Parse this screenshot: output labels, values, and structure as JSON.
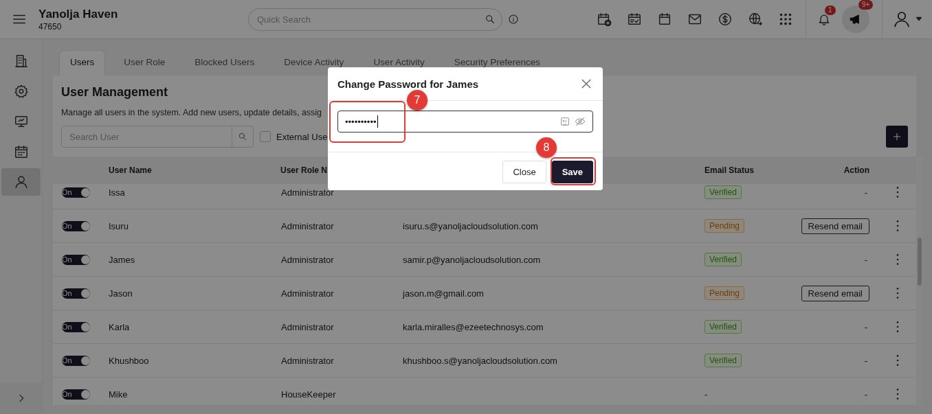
{
  "header": {
    "property_name": "Yanolja Haven",
    "property_code": "47650",
    "search": {
      "placeholder": "Quick Search"
    },
    "notification_badge": "1",
    "announcement_badge": "9+"
  },
  "sidebar": {
    "items": [
      {
        "kind": "building",
        "selected": false
      },
      {
        "kind": "gear",
        "selected": false
      },
      {
        "kind": "monitor",
        "selected": false
      },
      {
        "kind": "calendar",
        "selected": false
      },
      {
        "kind": "user",
        "selected": true
      }
    ]
  },
  "tabs": [
    {
      "label": "Users",
      "selected": true
    },
    {
      "label": "User Role",
      "selected": false
    },
    {
      "label": "Blocked Users",
      "selected": false
    },
    {
      "label": "Device Activity",
      "selected": false
    },
    {
      "label": "User Activity",
      "selected": false
    },
    {
      "label": "Security Preferences",
      "selected": false
    }
  ],
  "card": {
    "title": "User Management",
    "description": "Manage all users in the system. Add new users, update details, assig",
    "search": {
      "placeholder": "Search User"
    },
    "external_users": {
      "label": "External Use",
      "checked": false
    }
  },
  "table": {
    "columns": {
      "user_name": "User Name",
      "user_role": "User Role N",
      "email_status": "Email Status",
      "action": "Action"
    },
    "rows": [
      {
        "on": true,
        "toggle_label": "On",
        "name": "Issa",
        "role": "Administrator",
        "status": {
          "kind": "verified",
          "label": "Verified"
        },
        "action": {
          "kind": "none",
          "label": "-"
        }
      },
      {
        "on": true,
        "toggle_label": "On",
        "name": "Isuru",
        "role": "Administrator",
        "email": "isuru.s@yanoljacloudsolution.com",
        "status": {
          "kind": "pending",
          "label": "Pending"
        },
        "action": {
          "kind": "resend",
          "label": "Resend email"
        }
      },
      {
        "on": true,
        "toggle_label": "On",
        "name": "James",
        "role": "Administrator",
        "email": "samir.p@yanoljacloudsolution.com",
        "status": {
          "kind": "verified",
          "label": "Verified"
        },
        "action": {
          "kind": "none",
          "label": "-"
        }
      },
      {
        "on": true,
        "toggle_label": "On",
        "name": "Jason",
        "role": "Administrator",
        "email": "jason.m@gmail.com",
        "status": {
          "kind": "pending",
          "label": "Pending"
        },
        "action": {
          "kind": "resend",
          "label": "Resend email"
        }
      },
      {
        "on": true,
        "toggle_label": "On",
        "name": "Karla",
        "role": "Administrator",
        "email": "karla.miralles@ezeetechnosys.com",
        "status": {
          "kind": "verified",
          "label": "Verified"
        },
        "action": {
          "kind": "none",
          "label": "-"
        }
      },
      {
        "on": true,
        "toggle_label": "On",
        "name": "Khushboo",
        "role": "Administrator",
        "email": "khushboo.s@yanoljacloudsolution.com",
        "status": {
          "kind": "verified",
          "label": "Verified"
        },
        "action": {
          "kind": "none",
          "label": "-"
        }
      },
      {
        "on": true,
        "toggle_label": "On",
        "name": "Mike",
        "role": "HouseKeeper",
        "status": {
          "kind": "none",
          "label": "-"
        },
        "action": {
          "kind": "none",
          "label": "-"
        }
      }
    ]
  },
  "modal": {
    "title": "Change Password for James",
    "password": {
      "value": "••••••••••"
    },
    "buttons": [
      {
        "label": "Close",
        "kind": "secondary"
      },
      {
        "label": "Save",
        "kind": "primary"
      }
    ]
  },
  "annotations": [
    {
      "label": "7"
    },
    {
      "label": "8"
    }
  ]
}
